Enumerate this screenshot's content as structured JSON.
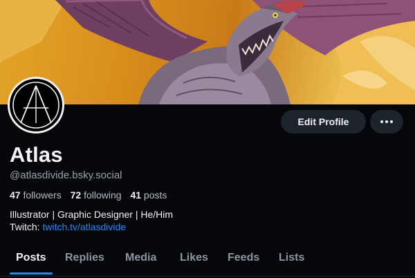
{
  "banner": {
    "alt": "banner-image"
  },
  "profile": {
    "display_name": "Atlas",
    "handle": "@atlasdivide.bsky.social",
    "followers_count": "47",
    "followers_label": "followers",
    "following_count": "72",
    "following_label": "following",
    "posts_count": "41",
    "posts_label": "posts",
    "bio_line1": "Illustrator | Graphic Designer | He/Him",
    "bio_line2_prefix": "Twitch: ",
    "bio_link": "twitch.tv/atlasdivide"
  },
  "actions": {
    "edit_profile_label": "Edit Profile",
    "more_icon": "more-horizontal-icon"
  },
  "tabs": [
    {
      "label": "Posts",
      "active": true
    },
    {
      "label": "Replies",
      "active": false
    },
    {
      "label": "Media",
      "active": false
    },
    {
      "label": "Likes",
      "active": false
    },
    {
      "label": "Feeds",
      "active": false
    },
    {
      "label": "Lists",
      "active": false
    }
  ],
  "colors": {
    "background": "#06070a",
    "accent": "#208bfe",
    "button_bg": "#1d232b",
    "muted_text": "#9aa3ad"
  }
}
